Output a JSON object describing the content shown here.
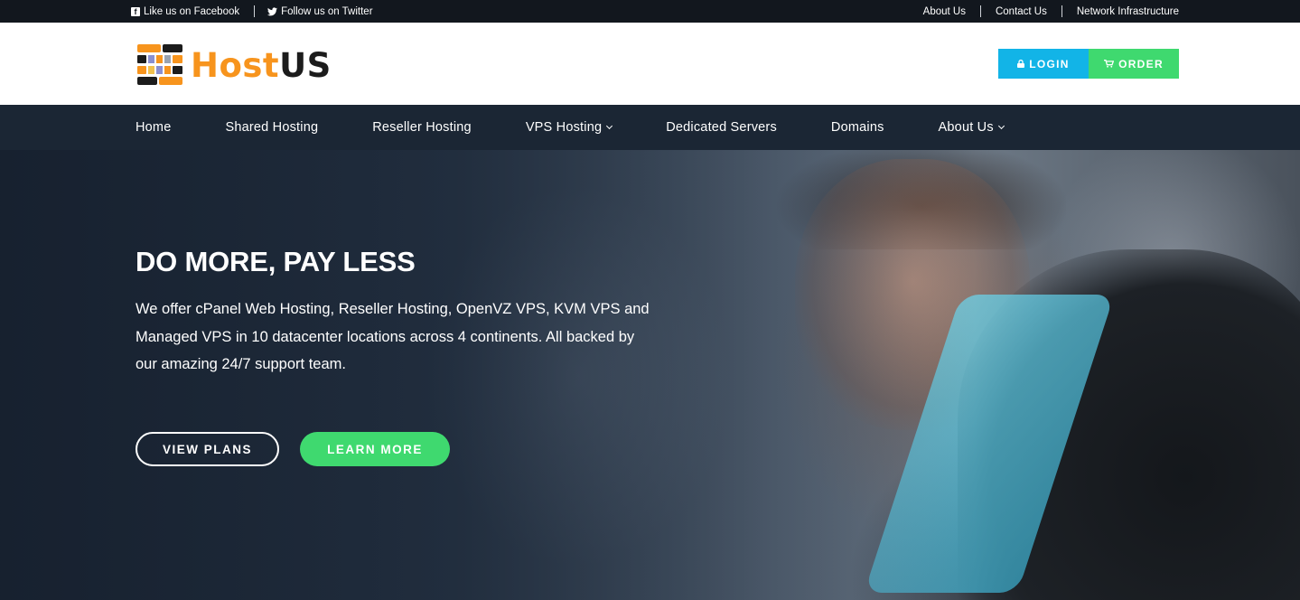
{
  "topbar": {
    "facebook": "Like us on Facebook",
    "twitter": "Follow us on Twitter",
    "links": [
      "About Us",
      "Contact Us",
      "Network Infrastructure"
    ]
  },
  "header": {
    "logo_host": "Host",
    "logo_us": "US",
    "login_label": "LOGIN",
    "order_label": "ORDER",
    "icons": {
      "login": "lock-icon",
      "order": "cart-icon"
    }
  },
  "nav": {
    "items": [
      {
        "label": "Home"
      },
      {
        "label": "Shared Hosting"
      },
      {
        "label": "Reseller Hosting"
      },
      {
        "label": "VPS Hosting"
      },
      {
        "label": "Dedicated Servers"
      },
      {
        "label": "Domains"
      },
      {
        "label": "About Us"
      }
    ]
  },
  "hero": {
    "title": "DO MORE, PAY LESS",
    "text": "We offer cPanel Web Hosting, Reseller Hosting, OpenVZ VPS, KVM VPS and Managed VPS in 10 datacenter locations across 4 continents. All backed by our amazing 24/7 support team.",
    "view_plans": "VIEW PLANS",
    "learn_more": "LEARN MORE"
  },
  "colors": {
    "brand_orange": "#f7941d",
    "login_blue": "#12b4e7",
    "order_green": "#3fd96f",
    "nav_bg": "#1b2634",
    "topbar_bg": "#12171e"
  }
}
